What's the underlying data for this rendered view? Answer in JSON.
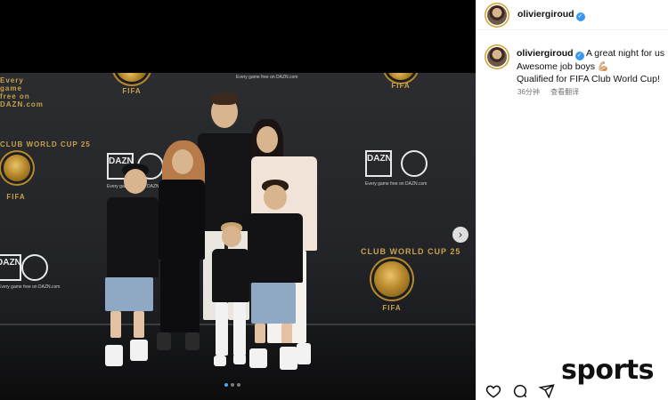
{
  "post": {
    "username": "oliviergiroud",
    "verified": true,
    "caption_lines": [
      "A great night for us 🙏",
      "Awesome job boys 💪🏼",
      "Qualified for FIFA Club World Cup!"
    ],
    "time_ago": "36分钟",
    "translate_label": "查看翻译"
  },
  "photo": {
    "fifa_label": "FIFA",
    "cwc_arc": "CLUB WORLD CUP 25",
    "dazn_label": "DAZN",
    "tagline": "Every game free on DAZN.com",
    "carousel_total": 3,
    "carousel_active": 1
  },
  "watermark": "sports",
  "icons": [
    "heart-icon",
    "comment-icon",
    "share-icon",
    "chevron-right-icon",
    "verified-icon"
  ],
  "colors": {
    "accent": "#3897f0",
    "gold": "#c9a24a",
    "story_ring": "#d6a22e"
  }
}
